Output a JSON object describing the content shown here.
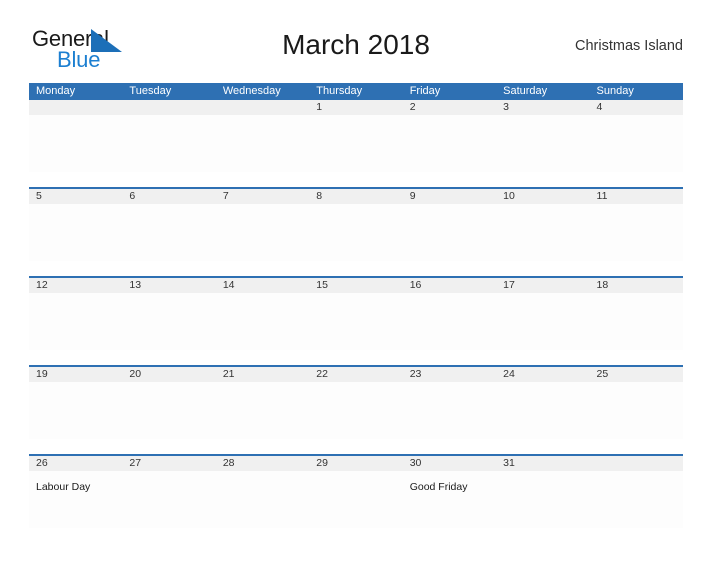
{
  "brand": {
    "name_part1": "General",
    "name_part2": "Blue",
    "flag_icon": "blue-triangle-flag-icon",
    "accent_color": "#1c7fd1"
  },
  "header": {
    "title": "March 2018",
    "locale": "Christmas Island"
  },
  "theme": {
    "header_blue": "#2e70b3",
    "band_gray": "#f0f0f0",
    "text_dark": "#1a1a1a"
  },
  "calendar": {
    "weekdays": [
      "Monday",
      "Tuesday",
      "Wednesday",
      "Thursday",
      "Friday",
      "Saturday",
      "Sunday"
    ],
    "weeks": [
      [
        {
          "date": "",
          "event": ""
        },
        {
          "date": "",
          "event": ""
        },
        {
          "date": "",
          "event": ""
        },
        {
          "date": "1",
          "event": ""
        },
        {
          "date": "2",
          "event": ""
        },
        {
          "date": "3",
          "event": ""
        },
        {
          "date": "4",
          "event": ""
        }
      ],
      [
        {
          "date": "5",
          "event": ""
        },
        {
          "date": "6",
          "event": ""
        },
        {
          "date": "7",
          "event": ""
        },
        {
          "date": "8",
          "event": ""
        },
        {
          "date": "9",
          "event": ""
        },
        {
          "date": "10",
          "event": ""
        },
        {
          "date": "11",
          "event": ""
        }
      ],
      [
        {
          "date": "12",
          "event": ""
        },
        {
          "date": "13",
          "event": ""
        },
        {
          "date": "14",
          "event": ""
        },
        {
          "date": "15",
          "event": ""
        },
        {
          "date": "16",
          "event": ""
        },
        {
          "date": "17",
          "event": ""
        },
        {
          "date": "18",
          "event": ""
        }
      ],
      [
        {
          "date": "19",
          "event": ""
        },
        {
          "date": "20",
          "event": ""
        },
        {
          "date": "21",
          "event": ""
        },
        {
          "date": "22",
          "event": ""
        },
        {
          "date": "23",
          "event": ""
        },
        {
          "date": "24",
          "event": ""
        },
        {
          "date": "25",
          "event": ""
        }
      ],
      [
        {
          "date": "26",
          "event": "Labour Day"
        },
        {
          "date": "27",
          "event": ""
        },
        {
          "date": "28",
          "event": ""
        },
        {
          "date": "29",
          "event": ""
        },
        {
          "date": "30",
          "event": "Good Friday"
        },
        {
          "date": "31",
          "event": ""
        },
        {
          "date": "",
          "event": ""
        }
      ]
    ]
  }
}
